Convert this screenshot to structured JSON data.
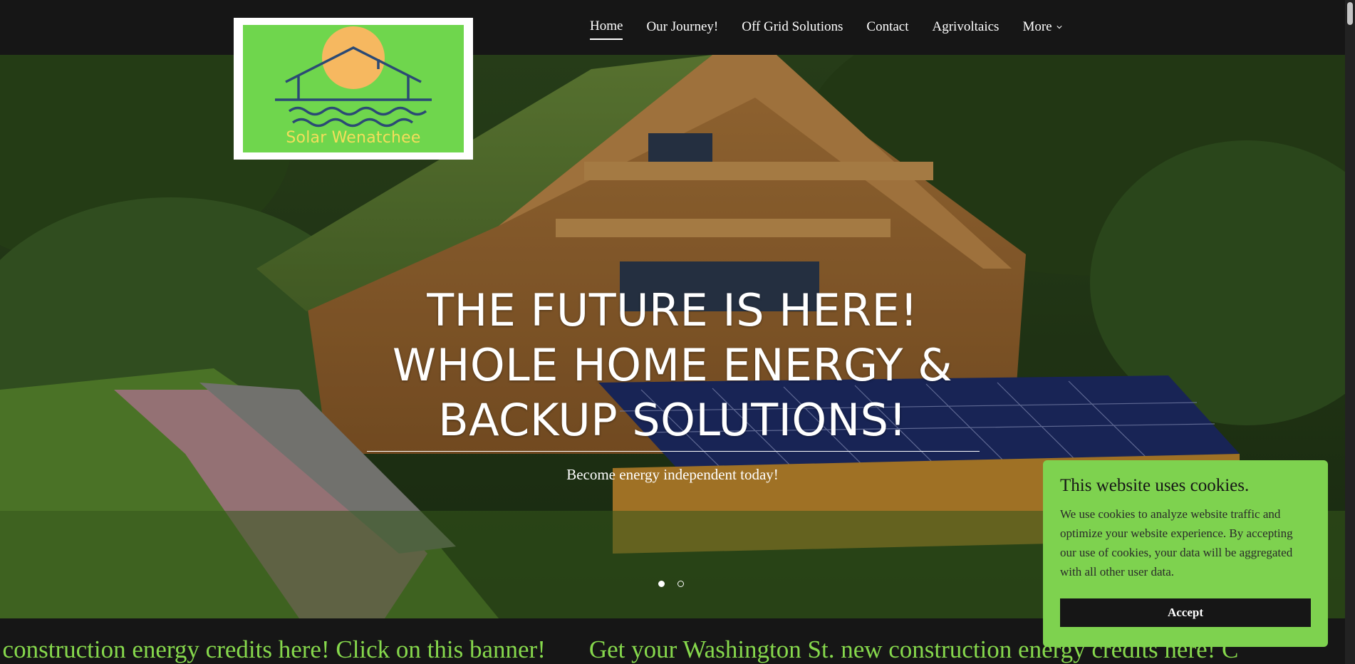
{
  "logo": {
    "text": "Solar Wenatchee",
    "bg_color": "#6fd64d",
    "sun_color": "#f6b860",
    "line_color": "#2b4a74",
    "text_color": "#f3de5b"
  },
  "nav": {
    "items": [
      {
        "label": "Home",
        "active": true
      },
      {
        "label": "Our Journey!",
        "active": false
      },
      {
        "label": "Off Grid Solutions",
        "active": false
      },
      {
        "label": "Contact",
        "active": false
      },
      {
        "label": "Agrivoltaics",
        "active": false
      },
      {
        "label": "More",
        "active": false,
        "icon": "chevron-down-icon"
      }
    ]
  },
  "hero": {
    "title_lines": [
      "THE FUTURE IS HERE!",
      "WHOLE HOME ENERGY &",
      "BACKUP SOLUTIONS!"
    ],
    "subtitle": "Become energy independent today!",
    "slides": {
      "count": 2,
      "active_index": 0
    }
  },
  "banner": {
    "items": [
      "ew construction energy credits here! Click on this banner!",
      "Get your Washington St. new construction energy credits here! C"
    ],
    "color": "#86d84c"
  },
  "cookie": {
    "title": "This website uses cookies.",
    "body": "We use cookies to analyze website traffic and optimize your website experience. By accepting our use of cookies, your data will be aggregated with all other user data.",
    "accept_label": "Accept",
    "bg_color": "#7ed24f"
  }
}
